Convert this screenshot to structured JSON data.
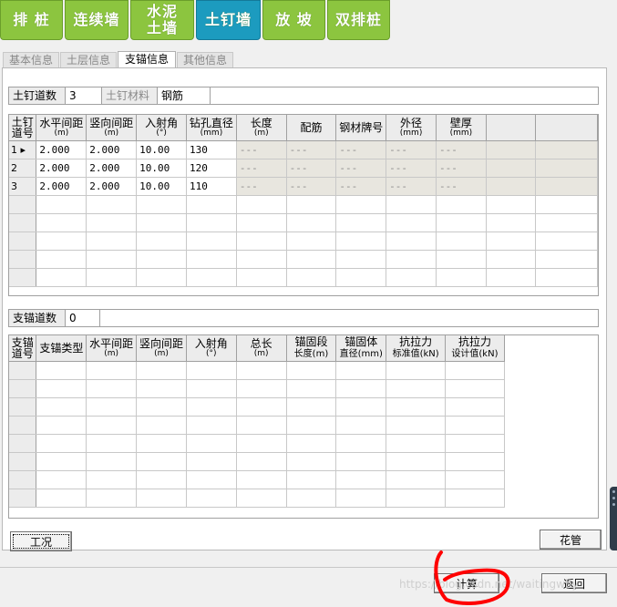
{
  "top_tabs": [
    {
      "label": "排 桩",
      "active": false
    },
    {
      "label": "连续墙",
      "active": false
    },
    {
      "label": "水泥\n土墙",
      "active": false
    },
    {
      "label": "土钉墙",
      "active": true
    },
    {
      "label": "放 坡",
      "active": false
    },
    {
      "label": "双排桩",
      "active": false
    }
  ],
  "sub_tabs": [
    "基本信息",
    "土层信息",
    "支锚信息",
    "其他信息"
  ],
  "soil_nail": {
    "count_label": "土钉道数",
    "count_value": "3",
    "material_label": "土钉材料",
    "material_value": "钢筋"
  },
  "nail_table": {
    "headers": [
      {
        "line1": "土钉",
        "line2": "道号",
        "unit": ""
      },
      {
        "line1": "水平间距",
        "line2": "",
        "unit": "(m)"
      },
      {
        "line1": "竖向间距",
        "line2": "",
        "unit": "(m)"
      },
      {
        "line1": "入射角",
        "line2": "",
        "unit": "(°)"
      },
      {
        "line1": "钻孔直径",
        "line2": "",
        "unit": "(mm)"
      },
      {
        "line1": "长度",
        "line2": "",
        "unit": "(m)"
      },
      {
        "line1": "配筋",
        "line2": "",
        "unit": ""
      },
      {
        "line1": "钢材牌号",
        "line2": "",
        "unit": ""
      },
      {
        "line1": "外径",
        "line2": "",
        "unit": "(mm)"
      },
      {
        "line1": "壁厚",
        "line2": "",
        "unit": "(mm)"
      },
      {
        "line1": "",
        "line2": "",
        "unit": ""
      },
      {
        "line1": "",
        "line2": "",
        "unit": ""
      }
    ],
    "rows": [
      [
        "1",
        "2.000",
        "2.000",
        "10.00",
        "130",
        "---",
        "---",
        "---",
        "---",
        "---"
      ],
      [
        "2",
        "2.000",
        "2.000",
        "10.00",
        "120",
        "---",
        "---",
        "---",
        "---",
        "---"
      ],
      [
        "3",
        "2.000",
        "2.000",
        "10.00",
        "110",
        "---",
        "---",
        "---",
        "---",
        "---"
      ]
    ]
  },
  "anchor": {
    "count_label": "支锚道数",
    "count_value": "0"
  },
  "anchor_table": {
    "headers": [
      {
        "line1": "支锚",
        "line2": "道号",
        "unit": ""
      },
      {
        "line1": "支锚类型",
        "line2": "",
        "unit": ""
      },
      {
        "line1": "水平间距",
        "line2": "",
        "unit": "(m)"
      },
      {
        "line1": "竖向间距",
        "line2": "",
        "unit": "(m)"
      },
      {
        "line1": "入射角",
        "line2": "",
        "unit": "(°)"
      },
      {
        "line1": "总长",
        "line2": "",
        "unit": "(m)"
      },
      {
        "line1": "锚固段",
        "line2": "长度(m)",
        "unit": ""
      },
      {
        "line1": "锚固体",
        "line2": "直径(mm)",
        "unit": ""
      },
      {
        "line1": "抗拉力",
        "line2": "标准值(kN)",
        "unit": ""
      },
      {
        "line1": "抗拉力",
        "line2": "设计值(kN)",
        "unit": ""
      }
    ]
  },
  "buttons": {
    "condition": "工况",
    "flower_pipe": "花管",
    "calculate": "计算",
    "back": "返回"
  },
  "watermark": "https://blog.csdn.net/waitingwhy",
  "colors": {
    "tab_green": "#8cc53f",
    "tab_active": "#1c9bbf",
    "annotation_red": "#ff0000"
  }
}
